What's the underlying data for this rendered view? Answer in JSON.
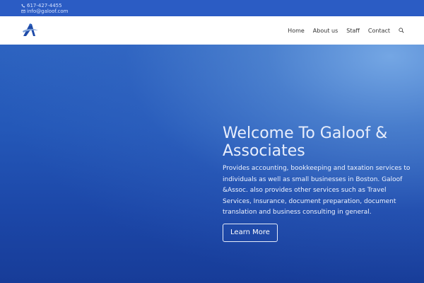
{
  "topbar": {
    "phone": "617-427-4455",
    "email": "info@galoof.com",
    "icons": {
      "phone": "phone-icon",
      "email": "envelope-icon"
    }
  },
  "header": {
    "logo": "company-logo-icon",
    "nav": [
      {
        "label": "Home"
      },
      {
        "label": "About us"
      },
      {
        "label": "Staff"
      },
      {
        "label": "Contact"
      }
    ],
    "search_icon": "search-icon"
  },
  "hero": {
    "title": "Welcome To Galoof & Associates",
    "text": "Provides accounting, bookkeeping and taxation services to individuals as well as small businesses in Boston. Galoof &Assoc. also provides other services such as Travel Services, Insurance, document preparation, document translation and business consulting in general.",
    "button_label": "Learn More"
  },
  "colors": {
    "topbar": "#2b5cc4",
    "header": "#ffffff",
    "hero_base": "#1c47a8",
    "hero_highlight": "#78aae6",
    "text_light": "#eef3ff"
  }
}
